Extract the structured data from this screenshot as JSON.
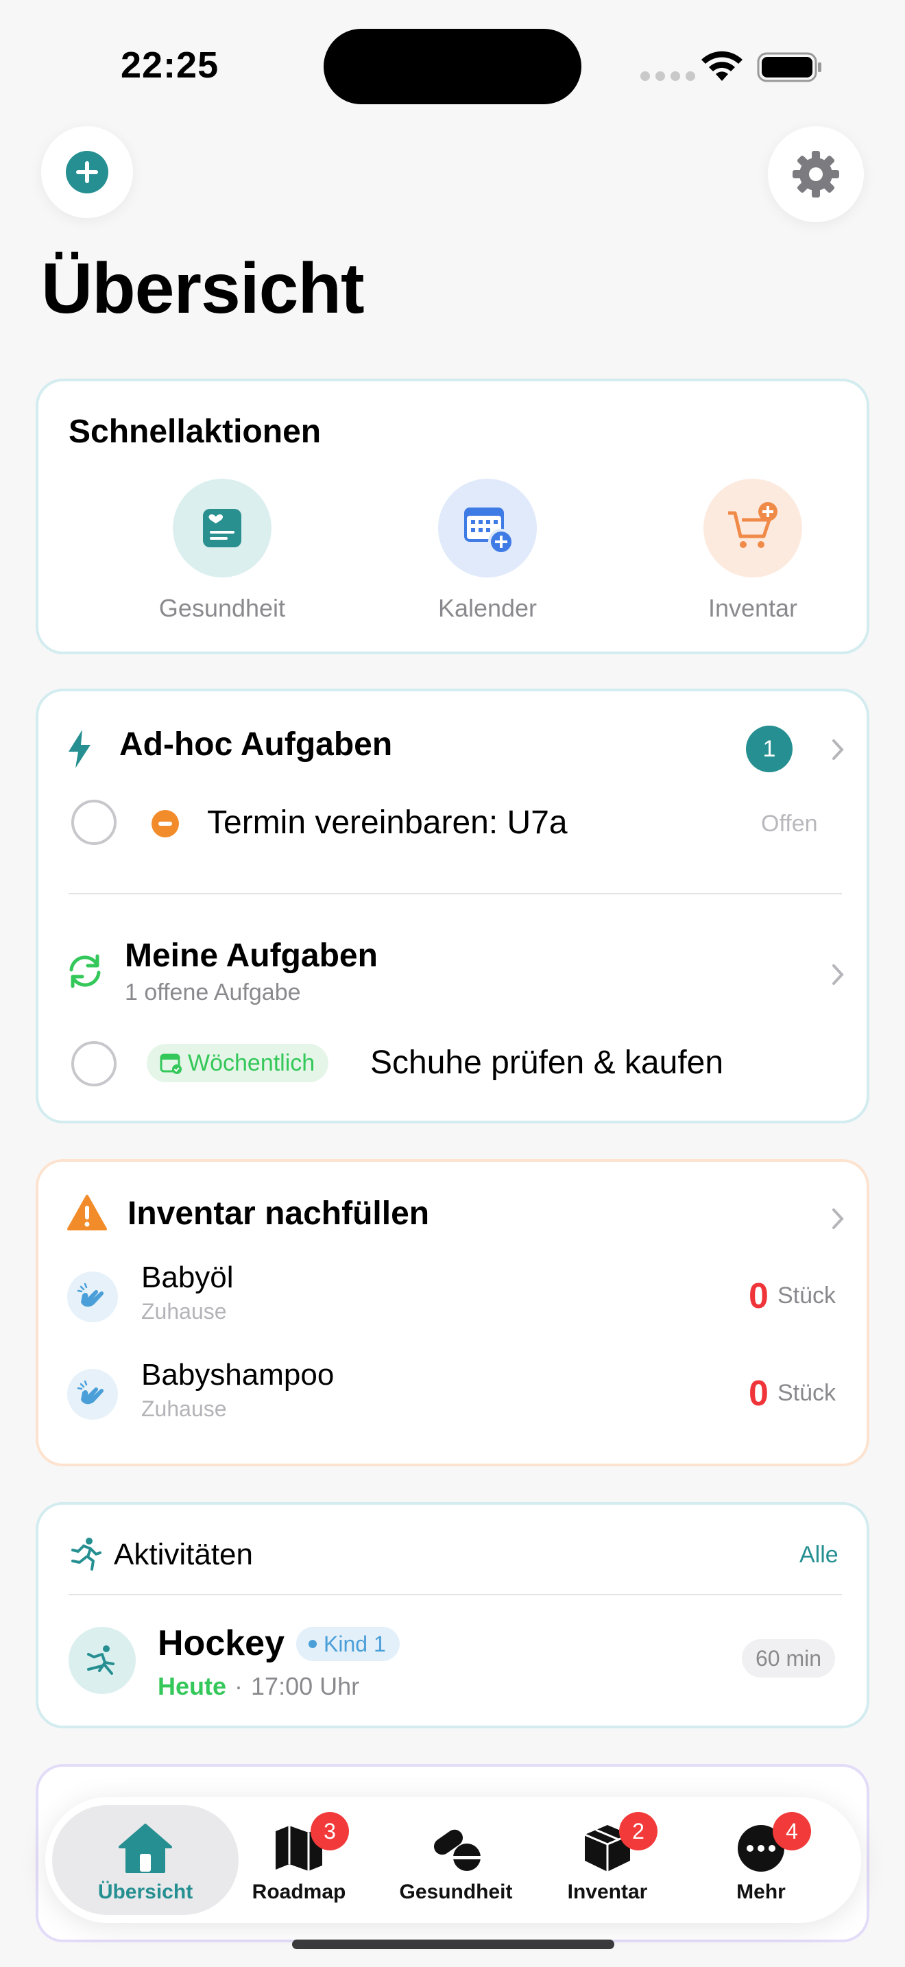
{
  "status": {
    "time": "22:25"
  },
  "header": {
    "title": "Übersicht"
  },
  "quick_actions": {
    "title": "Schnellaktionen",
    "items": [
      {
        "label": "Gesundheit",
        "icon": "health-card-icon",
        "color": "#2a8f8f"
      },
      {
        "label": "Kalender",
        "icon": "calendar-add-icon",
        "color": "#3f7be5"
      },
      {
        "label": "Inventar",
        "icon": "cart-add-icon",
        "color": "#f08a48"
      }
    ]
  },
  "adhoc": {
    "title": "Ad-hoc Aufgaben",
    "count": "1",
    "task": {
      "title": "Termin vereinbaren: U7a",
      "status": "Offen",
      "priority_icon": "minus-circle-icon"
    }
  },
  "my_tasks": {
    "title": "Meine Aufgaben",
    "subtitle": "1 offene Aufgabe",
    "task": {
      "tag": "Wöchentlich",
      "title": "Schuhe prüfen & kaufen"
    }
  },
  "inventory": {
    "title": "Inventar nachfüllen",
    "items": [
      {
        "name": "Babyöl",
        "location": "Zuhause",
        "qty": "0",
        "unit": "Stück"
      },
      {
        "name": "Babyshampoo",
        "location": "Zuhause",
        "qty": "0",
        "unit": "Stück"
      }
    ]
  },
  "activities": {
    "title": "Aktivitäten",
    "all_label": "Alle",
    "item": {
      "name": "Hockey",
      "child": "Kind 1",
      "day": "Heute",
      "sep": "·",
      "time": "17:00 Uhr",
      "duration": "60 min"
    }
  },
  "tabbar": {
    "tabs": [
      {
        "label": "Übersicht",
        "badge": ""
      },
      {
        "label": "Roadmap",
        "badge": "3"
      },
      {
        "label": "Gesundheit",
        "badge": ""
      },
      {
        "label": "Inventar",
        "badge": "2"
      },
      {
        "label": "Mehr",
        "badge": "4"
      }
    ]
  },
  "colors": {
    "teal": "#268f91",
    "green": "#34c759",
    "red": "#f23a3a",
    "orange": "#f28c2a",
    "blue": "#4a9fd8"
  }
}
